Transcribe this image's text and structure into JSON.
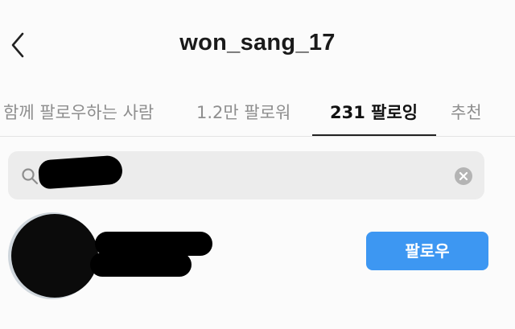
{
  "header": {
    "title": "won_sang_17",
    "back_icon": "chevron-left-icon"
  },
  "tabs": [
    {
      "label": "함께 팔로우하는 사람",
      "active": false
    },
    {
      "label": "1.2만 팔로워",
      "active": false
    },
    {
      "label": "231 팔로잉",
      "active": true
    },
    {
      "label": "추천",
      "active": false
    }
  ],
  "search": {
    "value": "",
    "icon": "search-icon",
    "clear_icon": "clear-icon"
  },
  "results": [
    {
      "follow_label": "팔로우"
    }
  ],
  "colors": {
    "accent": "#3d97f2",
    "background": "#fbfbfb",
    "search_bg": "#ececec"
  }
}
